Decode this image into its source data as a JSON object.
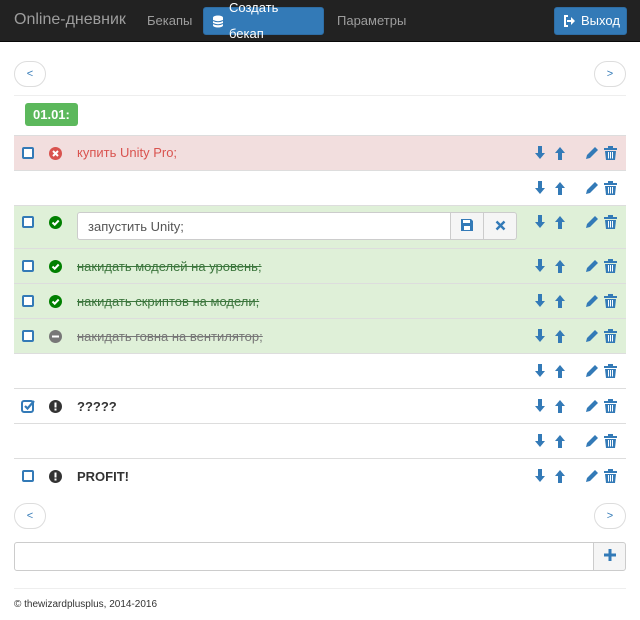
{
  "navbar": {
    "brand": "Online-дневник",
    "backups_link": "Бекапы",
    "create_backup_label": "Создать бекап",
    "settings_link": "Параметры",
    "logout_label": "Выход"
  },
  "pager": {
    "prev_label": "<",
    "next_label": ">"
  },
  "date_label": "01.01:",
  "todos": [
    {
      "text": "купить Unity Pro;",
      "status": "failed",
      "checked": false
    },
    {
      "text": "",
      "status": "none",
      "checked": false
    },
    {
      "text": "запустить Unity;",
      "status": "done",
      "checked": false,
      "editing": true
    },
    {
      "text": "накидать моделей на уровень;",
      "status": "done",
      "checked": false
    },
    {
      "text": "накидать скриптов на модели;",
      "status": "done",
      "checked": false
    },
    {
      "text": "накидать говна на вентилятор;",
      "status": "canceled",
      "checked": false
    },
    {
      "text": "",
      "status": "none",
      "checked": false
    },
    {
      "text": "?????",
      "status": "important",
      "checked": true
    },
    {
      "text": "",
      "status": "none",
      "checked": false
    },
    {
      "text": "PROFIT!",
      "status": "important",
      "checked": false
    }
  ],
  "new_todo": {
    "value": "",
    "placeholder": ""
  },
  "footer": {
    "text": "© thewizardplusplus, 2014-2016"
  },
  "colors": {
    "primary": "#337ab7",
    "success": "#5cb85c",
    "danger": "#d9534f",
    "danger_bg": "#f2dede",
    "success_bg": "#dff0d8",
    "success_icon": "#008000",
    "muted": "#777777"
  }
}
